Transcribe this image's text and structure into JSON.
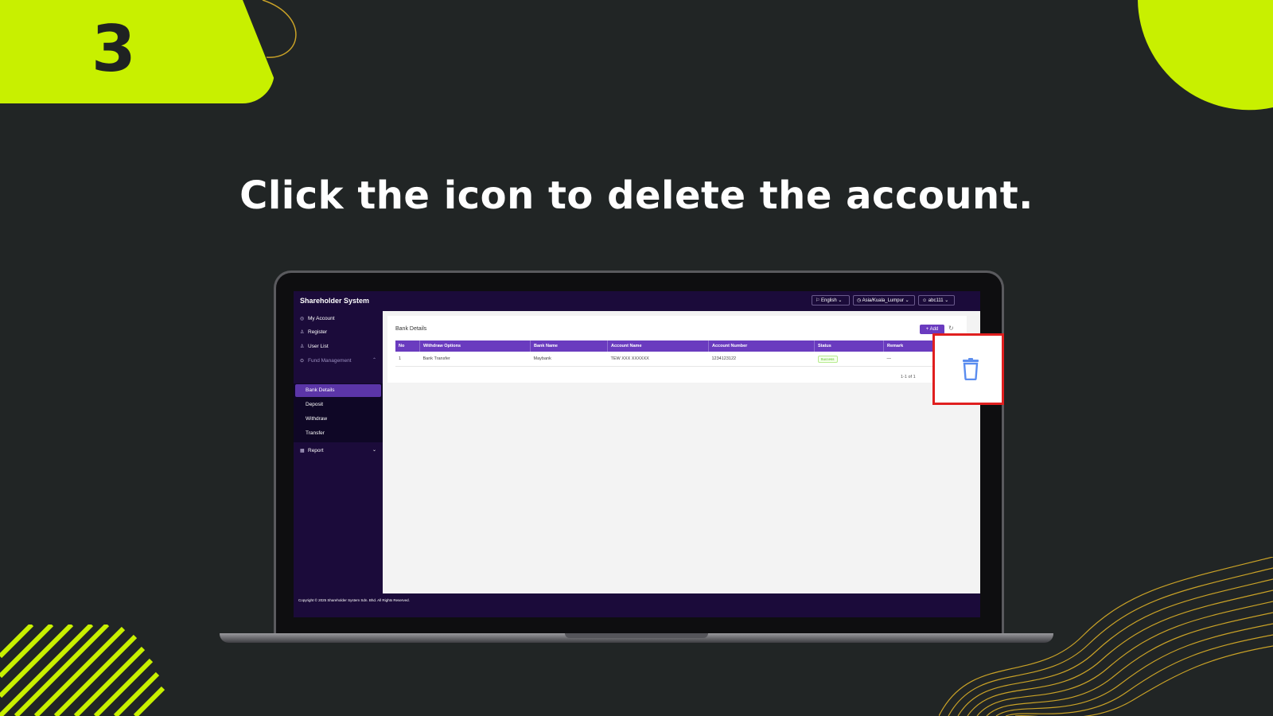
{
  "slide": {
    "step_number": "3",
    "instruction": "Click the icon to delete the account.",
    "accent_color": "#c8f000",
    "background_color": "#212525"
  },
  "app": {
    "title": "Shareholder System",
    "header": {
      "language": "English",
      "timezone": "Asia/Kuala_Lumpur",
      "user": "abc111"
    },
    "sidebar": {
      "items": [
        {
          "label": "My Account",
          "icon": "account-icon"
        },
        {
          "label": "Register",
          "icon": "user-icon"
        },
        {
          "label": "User List",
          "icon": "user-icon"
        },
        {
          "label": "Fund Management",
          "icon": "fund-icon"
        }
      ],
      "sub_items": [
        {
          "label": "Bank Details",
          "active": true
        },
        {
          "label": "Deposit"
        },
        {
          "label": "Withdraw"
        },
        {
          "label": "Transfer"
        }
      ],
      "report": {
        "label": "Report",
        "icon": "report-icon"
      }
    },
    "page": {
      "title": "Bank Details",
      "add_button": "+ Add",
      "table": {
        "columns": [
          "No",
          "Withdraw Options",
          "Bank Name",
          "Account Name",
          "Account Number",
          "Status",
          "Remark"
        ],
        "rows": [
          {
            "no": "1",
            "withdraw_option": "Bank Transfer",
            "bank_name": "Maybank",
            "account_name": "TEW XXX XXXXXX",
            "account_number": "1234123122",
            "status": "Success",
            "remark": "—"
          }
        ]
      },
      "pagination": "1-1 of 1"
    },
    "footer": "Copyright © 2025 Shareholder System Sdn. Bhd. All Rights Reserved.",
    "theme_color": "#6a3bbf"
  },
  "callout": {
    "icon": "trash-icon",
    "border_color": "#e01f1f"
  }
}
